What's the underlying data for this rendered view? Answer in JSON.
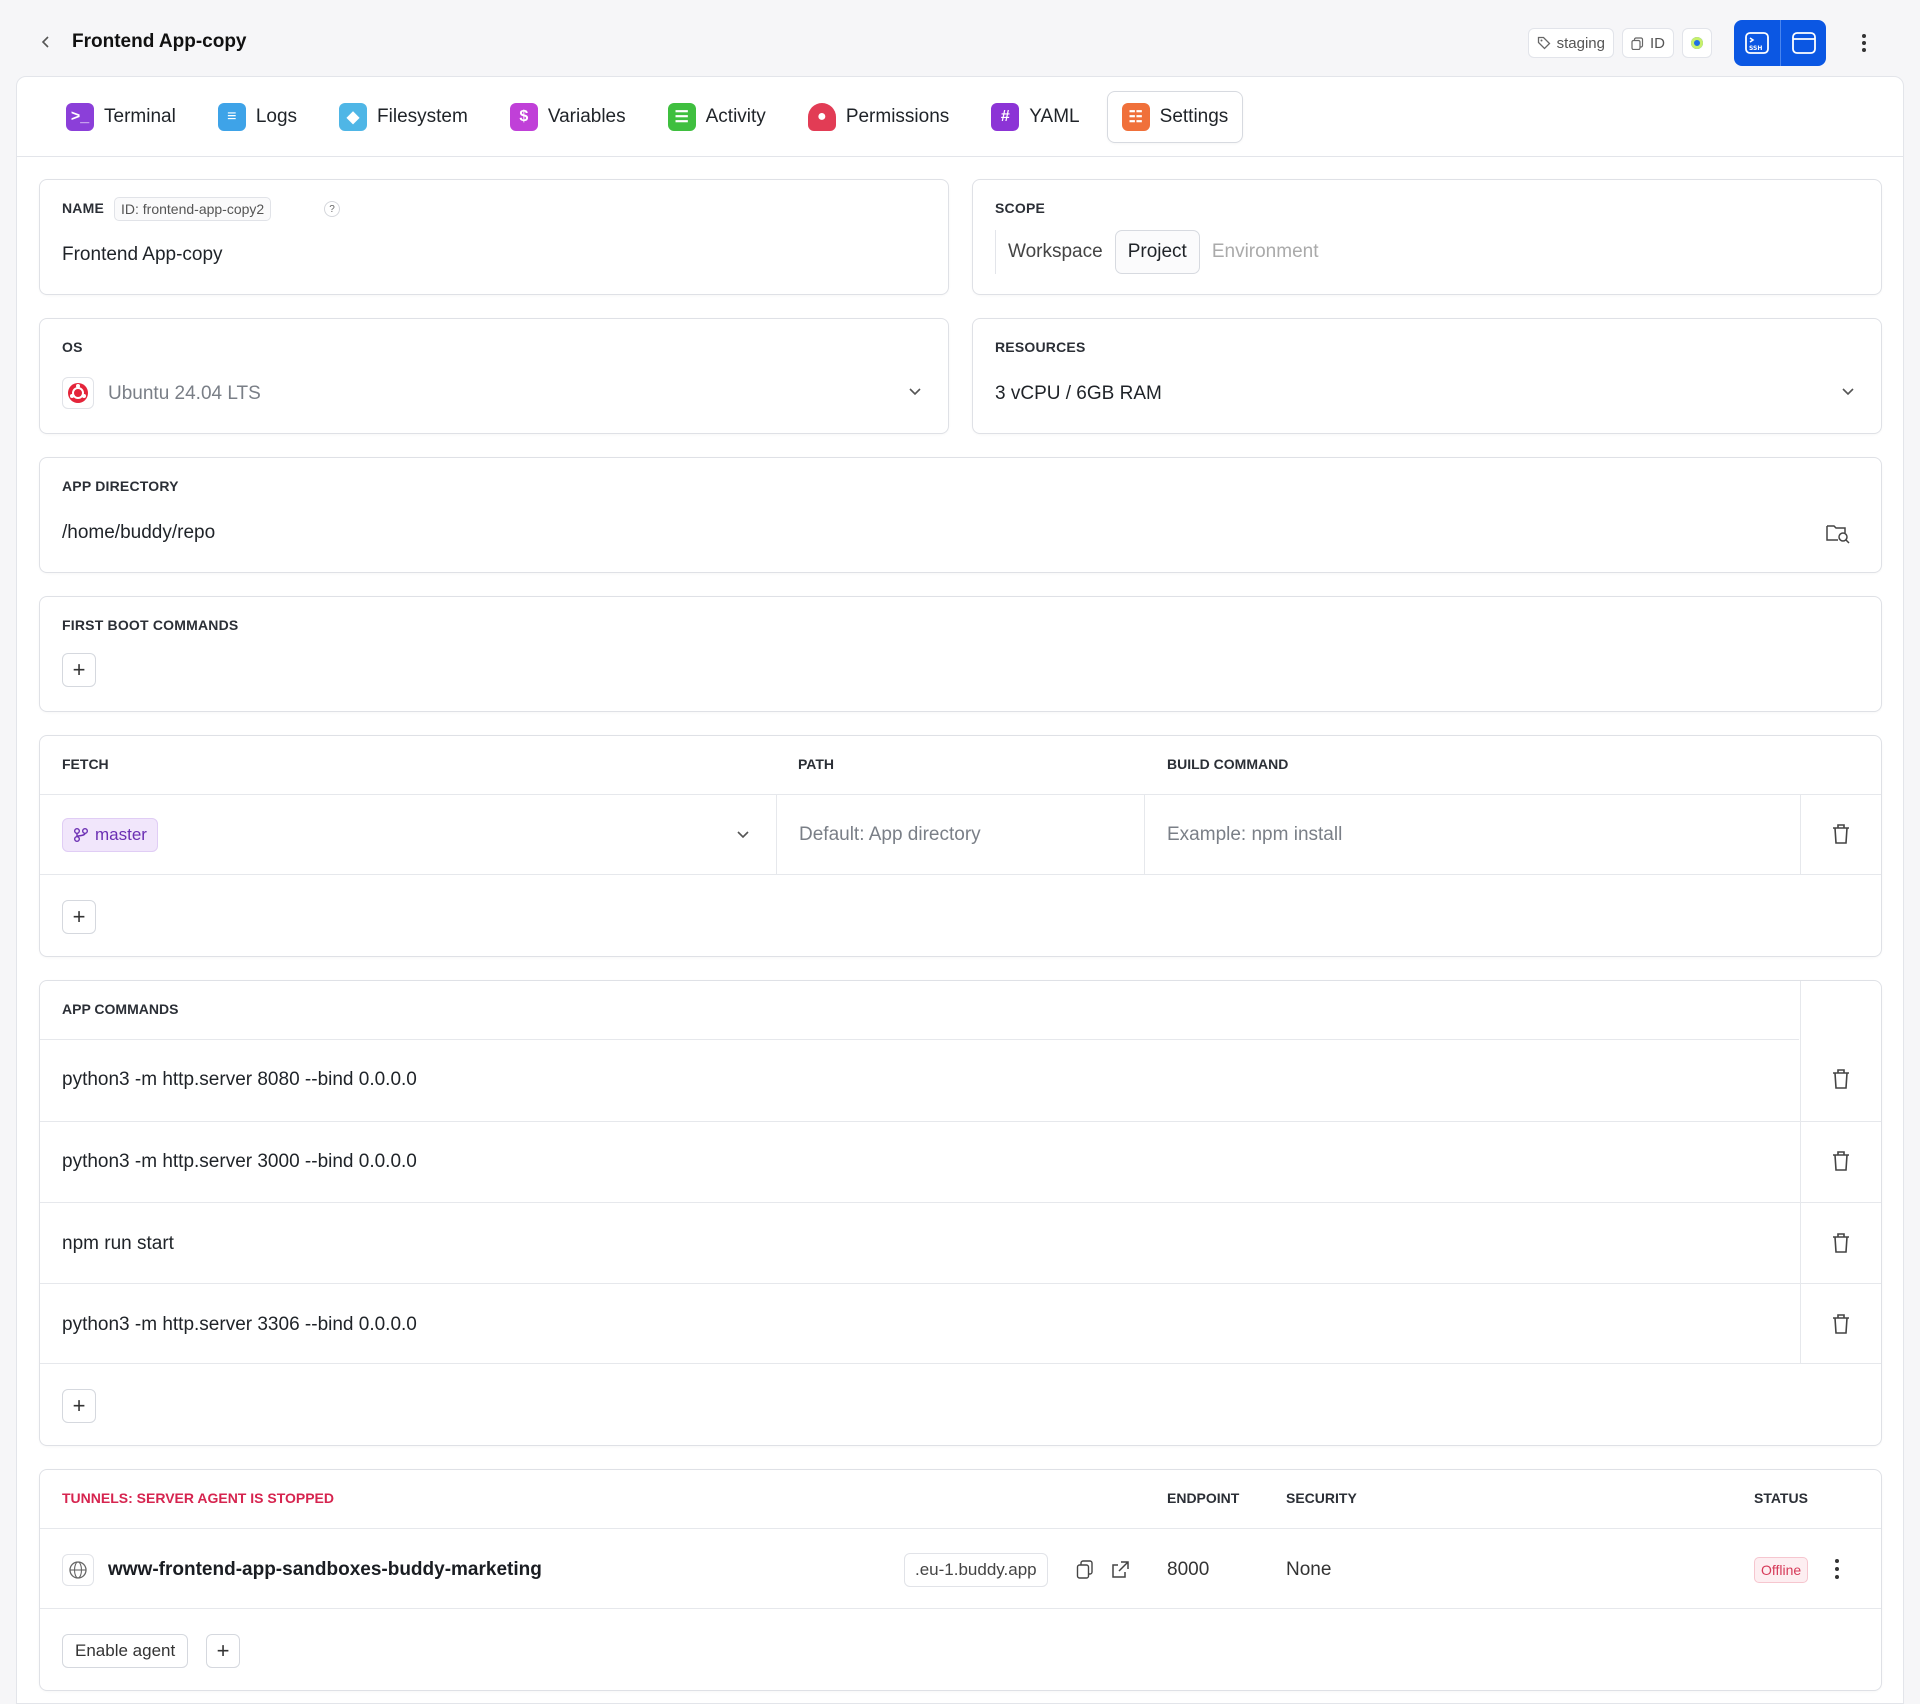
{
  "header": {
    "title": "Frontend App-copy",
    "tag_label": "staging",
    "id_label": "ID"
  },
  "tabs": [
    {
      "label": "Terminal",
      "icon": "terminal-icon",
      "color": "#8b3fd9"
    },
    {
      "label": "Logs",
      "icon": "logs-icon",
      "color": "#3ea3e8"
    },
    {
      "label": "Filesystem",
      "icon": "filesystem-icon",
      "color": "#4fb6e6"
    },
    {
      "label": "Variables",
      "icon": "dollar-icon",
      "color": "#c040d8"
    },
    {
      "label": "Activity",
      "icon": "activity-icon",
      "color": "#3fbf3f"
    },
    {
      "label": "Permissions",
      "icon": "lock-icon",
      "color": "#e23c55"
    },
    {
      "label": "YAML",
      "icon": "hash-icon",
      "color": "#8c34d6"
    },
    {
      "label": "Settings",
      "icon": "toggles-icon",
      "color": "#f0703a"
    }
  ],
  "active_tab": "Settings",
  "name": {
    "label": "NAME",
    "id_chip": "ID: frontend-app-copy2",
    "help": "?",
    "value": "Frontend App-copy"
  },
  "scope": {
    "label": "SCOPE",
    "options": [
      "Workspace",
      "Project",
      "Environment"
    ],
    "selected": "Project"
  },
  "os": {
    "label": "OS",
    "value": "Ubuntu 24.04 LTS"
  },
  "resources": {
    "label": "RESOURCES",
    "value": "3 vCPU / 6GB RAM"
  },
  "app_directory": {
    "label": "APP DIRECTORY",
    "value": "/home/buddy/repo"
  },
  "first_boot": {
    "label": "FIRST BOOT COMMANDS",
    "add": "+"
  },
  "fetch": {
    "headers": {
      "fetch": "FETCH",
      "path": "PATH",
      "build": "BUILD COMMAND"
    },
    "branch": "master",
    "path_placeholder": "Default: App directory",
    "build_placeholder": "Example: npm install",
    "add": "+"
  },
  "app_commands": {
    "label": "APP COMMANDS",
    "items": [
      "python3 -m http.server 8080 --bind 0.0.0.0",
      "python3 -m http.server 3000 --bind 0.0.0.0",
      "npm run start",
      "python3 -m http.server 3306 --bind 0.0.0.0"
    ],
    "add": "+"
  },
  "tunnels": {
    "label": "TUNNELS: SERVER AGENT IS STOPPED",
    "label_color": "#d6244f",
    "headers": {
      "endpoint": "ENDPOINT",
      "security": "SECURITY",
      "status": "STATUS"
    },
    "row": {
      "name": "www-frontend-app-sandboxes-buddy-marketing",
      "domain": ".eu-1.buddy.app",
      "endpoint": "8000",
      "security": "None",
      "status": "Offline"
    },
    "enable_agent": "Enable agent",
    "add": "+"
  }
}
